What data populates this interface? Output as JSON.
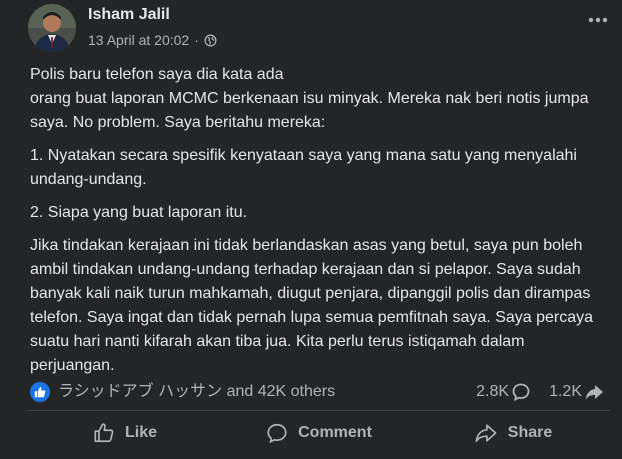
{
  "post": {
    "author": "Isham Jalil",
    "timestamp": "13 April at 20:02",
    "separator": "·",
    "audience_icon": "globe-icon",
    "more_icon": "more-options-icon",
    "paragraphs": [
      "Polis baru telefon saya dia kata ada\norang buat laporan MCMC berkenaan isu minyak. Mereka nak beri notis jumpa saya. No problem. Saya beritahu mereka:",
      "1. Nyatakan secara spesifik kenyataan saya yang mana satu yang menyalahi undang-undang.",
      "2. Siapa yang buat laporan itu.",
      "Jika tindakan kerajaan ini tidak berlandaskan asas yang betul, saya pun boleh ambil tindakan undang-undang terhadap kerajaan dan si pelapor. Saya sudah banyak kali naik turun mahkamah, diugut penjara, dipanggil polis dan dirampas telefon. Saya ingat dan tidak pernah lupa semua pemfitnah saya. Saya percaya suatu hari nanti kifarah akan tiba jua. Kita perlu terus istiqamah dalam perjuangan."
    ]
  },
  "stats": {
    "reactions_text": "ラシッドアブ ハッサン and 42K others",
    "comments_count": "2.8K",
    "shares_count": "1.2K"
  },
  "actions": {
    "like_label": "Like",
    "comment_label": "Comment",
    "share_label": "Share"
  },
  "colors": {
    "background": "#242526",
    "text_primary": "#e4e6eb",
    "text_secondary": "#b0b3b8",
    "like_blue": "#1b74e4"
  }
}
